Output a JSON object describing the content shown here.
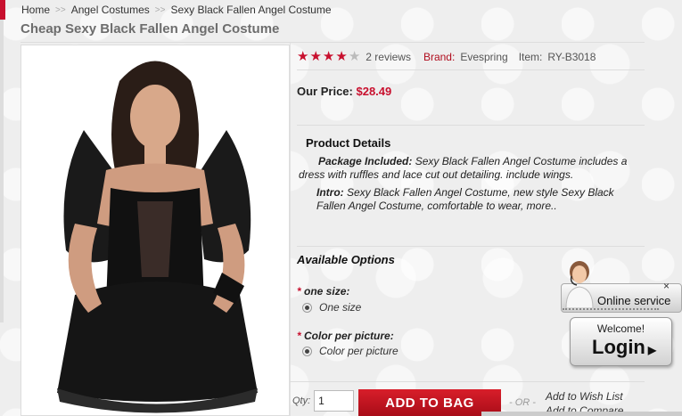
{
  "breadcrumb": {
    "home": "Home",
    "sep": ">>",
    "category": "Angel Costumes",
    "current": "Sexy Black Fallen Angel Costume"
  },
  "product": {
    "title": "Cheap Sexy Black Fallen Angel Costume",
    "rating": 4,
    "rating_max": 5,
    "reviews": "2 reviews",
    "brand_label": "Brand:",
    "brand": "Evespring",
    "item_label": "Item:",
    "item": "RY-B3018",
    "price_label": "Our Price:",
    "price": "$28.49"
  },
  "details": {
    "title": "Product Details",
    "package_label": "Package Included:",
    "package_text": "Sexy Black Fallen Angel Costume includes a dress with ruffles and lace cut out detailing. include wings.",
    "intro_label": "Intro:",
    "intro_text": "Sexy Black Fallen Angel Costume, new style Sexy Black Fallen Angel Costume, comfortable to wear, more.."
  },
  "options": {
    "title": "Available Options",
    "required_mark": "*",
    "groups": [
      {
        "label": "one size:",
        "choice": "One size"
      },
      {
        "label": "Color per picture:",
        "choice": "Color per picture"
      }
    ]
  },
  "cart": {
    "qty_label": "Qty:",
    "qty_value": "1",
    "add_button": "ADD TO BAG",
    "or": "- OR -",
    "wishlist": "Add to Wish List",
    "compare": "Add to Compare"
  },
  "chat": {
    "online": "Online service",
    "welcome": "Welcome!",
    "login": "Login",
    "close": "×"
  },
  "colors": {
    "accent": "#c8102e",
    "price": "#c8102e"
  }
}
